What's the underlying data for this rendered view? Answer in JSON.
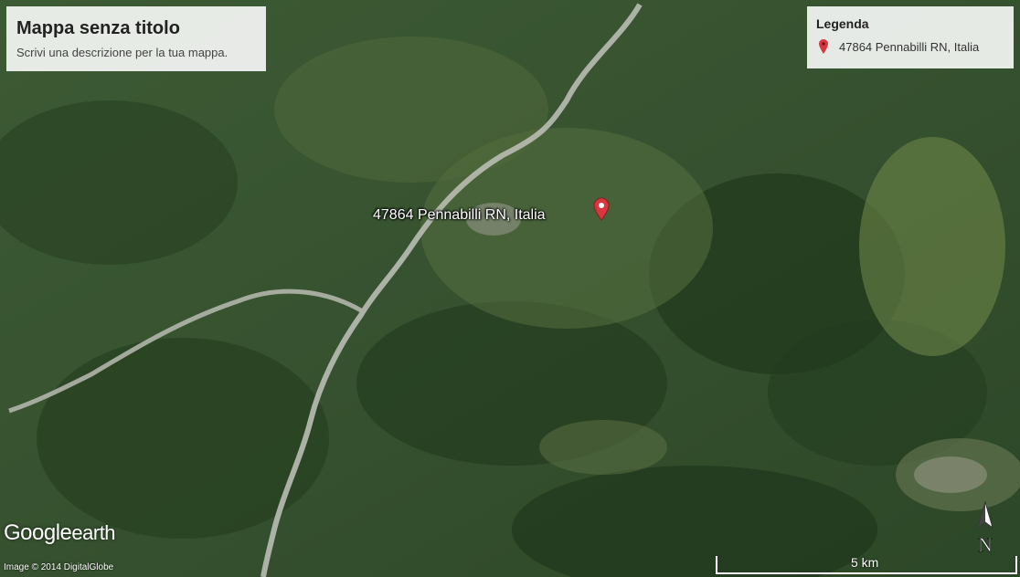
{
  "map": {
    "title": "Mappa senza titolo",
    "description": "Scrivi una descrizione per la tua mappa.",
    "legend": {
      "heading": "Legenda",
      "items": [
        {
          "label": "47864 Pennabilli RN, Italia",
          "icon": "map-pin-icon",
          "color": "#d9363e"
        }
      ]
    },
    "marker_label": "47864 Pennabilli RN, Italia",
    "marker_color": "#d9363e"
  },
  "branding": {
    "logo_google": "Google",
    "logo_earth": "earth",
    "credit": "Image © 2014 DigitalGlobe"
  },
  "compass": {
    "label": "N"
  },
  "scale": {
    "label": "5 km"
  }
}
